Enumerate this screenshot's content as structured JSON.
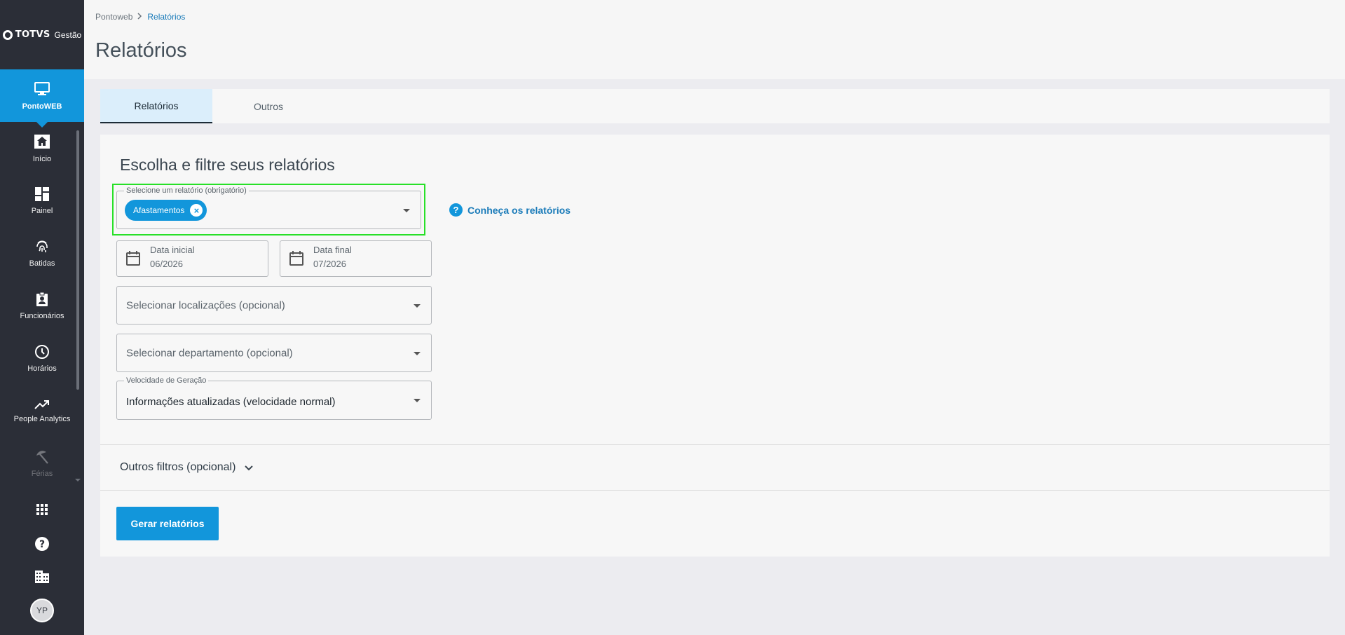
{
  "brand": {
    "name": "TOTVS",
    "suffix": "Gestão"
  },
  "sidebar": {
    "active_app": {
      "label": "PontoWEB",
      "icon": "monitor-icon"
    },
    "items": [
      {
        "label": "Início",
        "icon": "home-icon"
      },
      {
        "label": "Painel",
        "icon": "dashboard-icon"
      },
      {
        "label": "Batidas",
        "icon": "fingerprint-icon"
      },
      {
        "label": "Funcionários",
        "icon": "badge-icon"
      },
      {
        "label": "Horários",
        "icon": "clock-icon"
      },
      {
        "label": "People Analytics",
        "icon": "trending-up-icon"
      },
      {
        "label": "Férias",
        "icon": "beach-umbrella-icon"
      }
    ],
    "avatar_initials": "YP"
  },
  "header": {
    "breadcrumb": {
      "root": "Pontoweb",
      "current": "Relatórios"
    },
    "title": "Relatórios"
  },
  "tabs": [
    {
      "label": "Relatórios",
      "active": true
    },
    {
      "label": "Outros",
      "active": false
    }
  ],
  "form": {
    "title": "Escolha e filtre seus relatórios",
    "report_select": {
      "legend": "Selecione um relatório (obrigatório)",
      "chip": "Afastamentos"
    },
    "help_link": "Conheça os relatórios",
    "start_date": {
      "label": "Data inicial",
      "value": "06/2026"
    },
    "end_date": {
      "label": "Data final",
      "value": "07/2026"
    },
    "locations_placeholder": "Selecionar localizações (opcional)",
    "department_placeholder": "Selecionar departamento (opcional)",
    "speed": {
      "legend": "Velocidade de Geração",
      "value": "Informações atualizadas (velocidade normal)"
    },
    "more_filters": "Outros filtros (opcional)",
    "generate_button": "Gerar relatórios"
  },
  "colors": {
    "accent": "#1296db",
    "sidebar": "#2b2e37",
    "highlight": "#28e028"
  }
}
